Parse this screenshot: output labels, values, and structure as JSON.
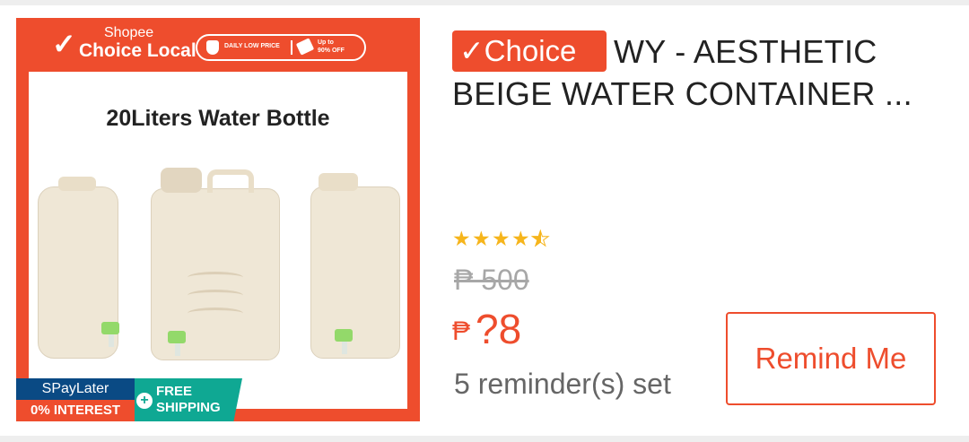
{
  "product": {
    "image": {
      "brand_top": "Shopee",
      "brand_main": "Choice Local",
      "promo_left": "DAILY LOW PRICE",
      "promo_right_line1": "Up to",
      "promo_right_line2": "90% OFF",
      "image_title": "20Liters Water Bottle",
      "spaylater_top": "SPayLater",
      "spaylater_bottom": "0% INTEREST",
      "free_shipping_line1": "FREE",
      "free_shipping_line2": "SHIPPING"
    },
    "choice_badge": "✓Choice",
    "title_line1": "WY - AESTHETIC",
    "title_line2": "BEIGE WATER CONTAINER ...",
    "rating": 4.5,
    "old_price": "₱ 500",
    "price_currency": "₱",
    "price_value": "?8",
    "reminders_text": "5 reminder(s) set",
    "remind_button_label": "Remind Me"
  },
  "colors": {
    "accent": "#ee4d2d",
    "star": "#f6b51c",
    "spaylater_blue": "#0a4a84",
    "free_shipping_teal": "#0fa893"
  },
  "icons": [
    "check-icon",
    "shield-icon",
    "tag-icon",
    "star-icon",
    "plus-icon"
  ]
}
